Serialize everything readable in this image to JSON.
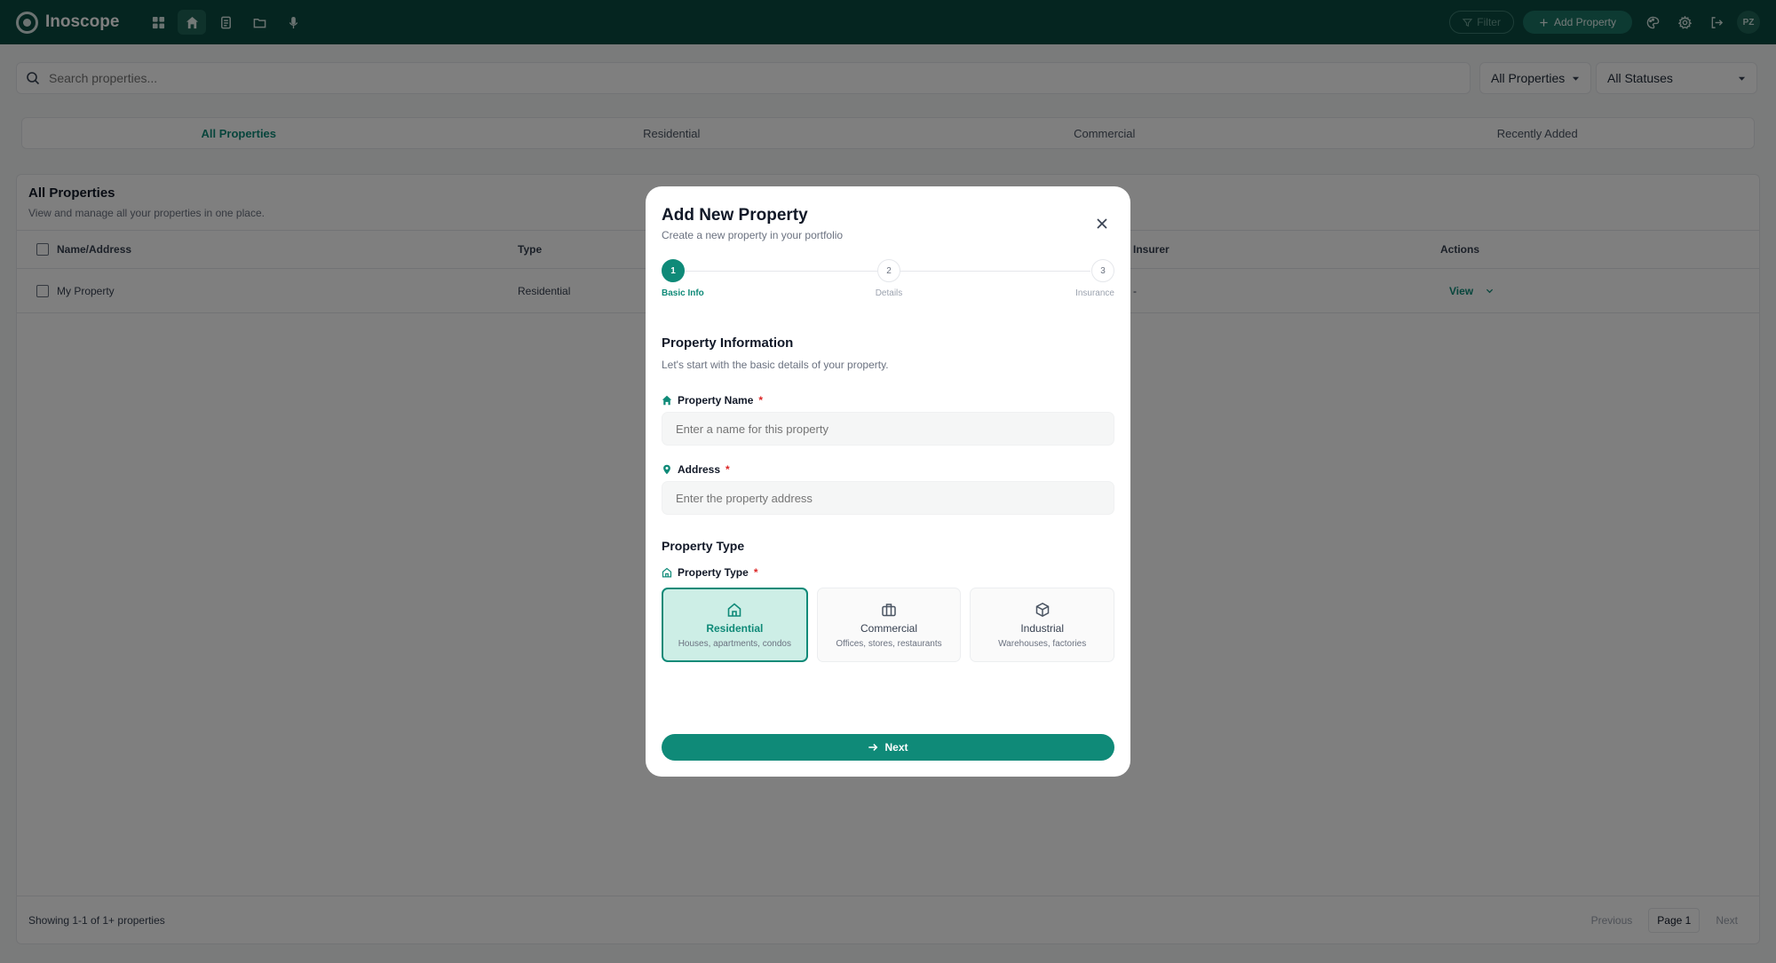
{
  "app": {
    "name": "Inoscope"
  },
  "topbar": {
    "nav_icons": [
      "dashboard-icon",
      "home-icon",
      "document-icon",
      "folder-icon",
      "microphone-icon"
    ],
    "filter_label": "Filter",
    "add_property_label": "Add Property",
    "right_icons": [
      "palette-icon",
      "gear-icon",
      "logout-icon"
    ],
    "avatar_initials": "PZ"
  },
  "search": {
    "placeholder": "Search properties..."
  },
  "filters": {
    "properties": "All Properties",
    "statuses": "All Statuses"
  },
  "tabs": [
    "All Properties",
    "Residential",
    "Commercial",
    "Recently Added"
  ],
  "list": {
    "title": "All Properties",
    "subtitle": "View and manage all your properties in one place.",
    "columns": {
      "name": "Name/Address",
      "type": "Type",
      "insurer": "Insurer",
      "actions": "Actions"
    },
    "rows": [
      {
        "name": "My Property",
        "type": "Residential",
        "insurer": "-",
        "action": "View"
      }
    ],
    "footer": {
      "showing": "Showing 1-1 of 1+ properties",
      "previous": "Previous",
      "page": "Page 1",
      "next": "Next"
    }
  },
  "modal": {
    "title": "Add New Property",
    "subtitle": "Create a new property in your portfolio",
    "steps": [
      {
        "number": "1",
        "label": "Basic Info",
        "active": true
      },
      {
        "number": "2",
        "label": "Details",
        "active": false
      },
      {
        "number": "3",
        "label": "Insurance",
        "active": false
      }
    ],
    "info_section": {
      "title": "Property Information",
      "subtitle": "Let's start with the basic details of your property."
    },
    "property_name": {
      "label": "Property Name",
      "required_mark": "*",
      "placeholder": "Enter a name for this property",
      "value": ""
    },
    "address": {
      "label": "Address",
      "required_mark": "*",
      "placeholder": "Enter the property address",
      "value": ""
    },
    "type_section": {
      "title": "Property Type",
      "label": "Property Type",
      "required_mark": "*"
    },
    "type_options": [
      {
        "name": "Residential",
        "description": "Houses, apartments, condos",
        "icon": "home-outline-icon",
        "selected": true
      },
      {
        "name": "Commercial",
        "description": "Offices, stores, restaurants",
        "icon": "briefcase-icon",
        "selected": false
      },
      {
        "name": "Industrial",
        "description": "Warehouses, factories",
        "icon": "box-icon",
        "selected": false
      }
    ],
    "next_label": "Next"
  },
  "colors": {
    "topbar": "#0b4a40",
    "accent": "#0f8a78",
    "selected_bg": "#cdeee6",
    "required": "#dc2626"
  }
}
